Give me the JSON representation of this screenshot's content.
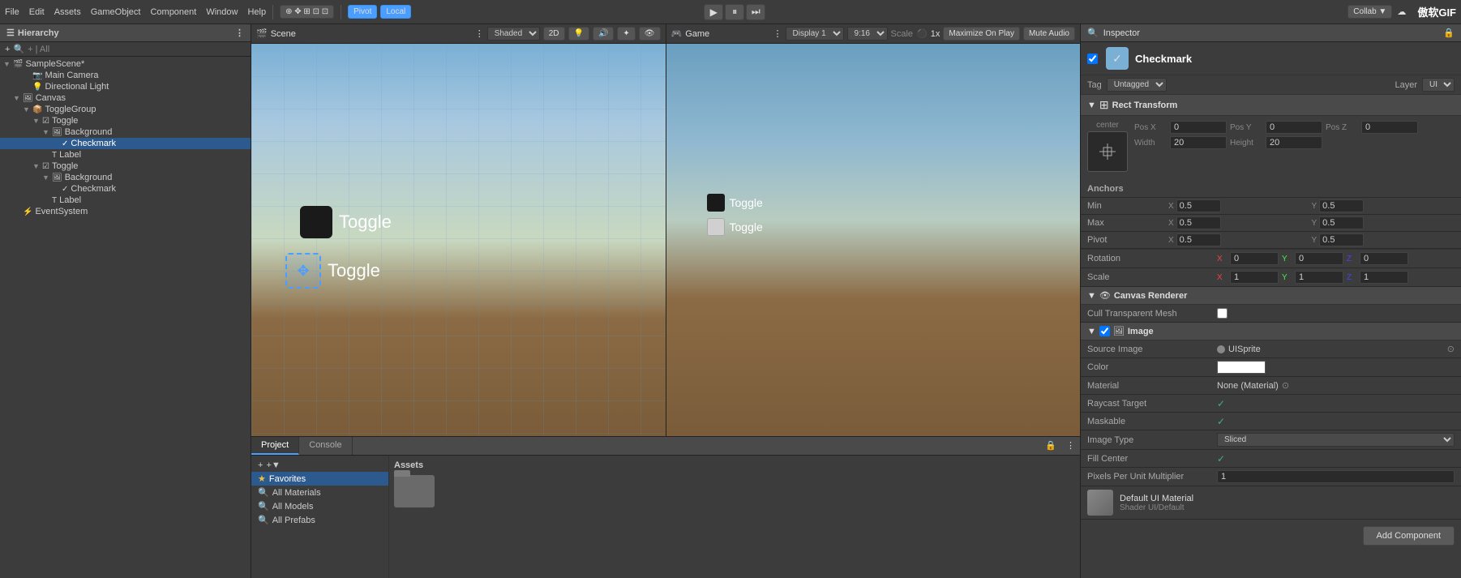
{
  "toolbar": {
    "menus": [
      "File",
      "Edit",
      "Assets",
      "GameObject",
      "Component",
      "Window",
      "Help"
    ],
    "pivot_label": "Pivot",
    "local_label": "Local",
    "play_icon": "▶",
    "pause_icon": "⏸",
    "step_icon": "⏭",
    "collab_label": "Collab ▼",
    "brand_name": "傲软GIF"
  },
  "hierarchy": {
    "title": "Hierarchy",
    "search_placeholder": "+ | All",
    "scene_name": "SampleScene*",
    "items": [
      {
        "id": "main-camera",
        "label": "Main Camera",
        "depth": 2,
        "icon": "📷"
      },
      {
        "id": "directional-light",
        "label": "Directional Light",
        "depth": 2,
        "icon": "💡"
      },
      {
        "id": "canvas",
        "label": "Canvas",
        "depth": 1,
        "icon": "🖼"
      },
      {
        "id": "toggle-group",
        "label": "ToggleGroup",
        "depth": 2,
        "icon": "📦"
      },
      {
        "id": "toggle-1",
        "label": "Toggle",
        "depth": 3,
        "icon": "☑"
      },
      {
        "id": "background-1",
        "label": "Background",
        "depth": 4,
        "icon": "🖼"
      },
      {
        "id": "checkmark-1",
        "label": "Checkmark",
        "depth": 5,
        "icon": "✓",
        "selected": true
      },
      {
        "id": "label-1",
        "label": "Label",
        "depth": 4,
        "icon": "T"
      },
      {
        "id": "toggle-2",
        "label": "Toggle",
        "depth": 3,
        "icon": "☑"
      },
      {
        "id": "background-2",
        "label": "Background",
        "depth": 4,
        "icon": "🖼"
      },
      {
        "id": "checkmark-2",
        "label": "Checkmark",
        "depth": 5,
        "icon": "✓"
      },
      {
        "id": "label-2",
        "label": "Label",
        "depth": 4,
        "icon": "T"
      },
      {
        "id": "event-system",
        "label": "EventSystem",
        "depth": 1,
        "icon": "⚡"
      }
    ]
  },
  "scene": {
    "title": "Scene",
    "shading": "Shaded",
    "mode_2d": "2D",
    "toggle1_label": "Toggle",
    "toggle2_label": "Toggle"
  },
  "game": {
    "title": "Game",
    "display": "Display 1",
    "aspect": "9:16",
    "scale_label": "Scale",
    "scale_value": "1x",
    "maximize": "Maximize On Play",
    "mute": "Mute Audio",
    "toggle1_label": "Toggle",
    "toggle2_label": "Toggle"
  },
  "inspector": {
    "title": "Inspector",
    "go_name": "Checkmark",
    "tag_label": "Tag",
    "tag_value": "Untagged",
    "layer_label": "Layer",
    "layer_value": "UI",
    "rect_transform": {
      "title": "Rect Transform",
      "center_label": "center",
      "pos_x_label": "Pos X",
      "pos_x_value": "0",
      "pos_y_label": "Pos Y",
      "pos_y_value": "0",
      "pos_z_label": "Pos Z",
      "pos_z_value": "0",
      "width_label": "Width",
      "width_value": "20",
      "height_label": "Height",
      "height_value": "20"
    },
    "anchors": {
      "title": "Anchors",
      "min_label": "Min",
      "min_x": "0.5",
      "min_y": "0.5",
      "max_label": "Max",
      "max_x": "0.5",
      "max_y": "0.5",
      "pivot_label": "Pivot",
      "pivot_x": "0.5",
      "pivot_y": "0.5"
    },
    "rotation": {
      "title": "Rotation",
      "x": "0",
      "y": "0",
      "z": "0"
    },
    "scale": {
      "title": "Scale",
      "x": "1",
      "y": "1",
      "z": "1"
    },
    "canvas_renderer": {
      "title": "Canvas Renderer",
      "cull_label": "Cull Transparent Mesh"
    },
    "image": {
      "title": "Image",
      "source_image_label": "Source Image",
      "source_image_value": "UISprite",
      "color_label": "Color",
      "material_label": "Material",
      "material_value": "None (Material)",
      "raycast_label": "Raycast Target",
      "maskable_label": "Maskable",
      "image_type_label": "Image Type",
      "image_type_value": "Sliced",
      "fill_center_label": "Fill Center",
      "pixels_label": "Pixels Per Unit Multiplier",
      "pixels_value": "1"
    },
    "default_material": {
      "name": "Default UI Material",
      "shader_label": "Shader",
      "shader_value": "UI/Default"
    },
    "add_component_label": "Add Component"
  },
  "project": {
    "title": "Project",
    "console_label": "Console",
    "favorites_label": "Favorites",
    "items": [
      {
        "label": "All Materials"
      },
      {
        "label": "All Models"
      },
      {
        "label": "All Prefabs"
      }
    ],
    "assets_label": "Assets"
  }
}
